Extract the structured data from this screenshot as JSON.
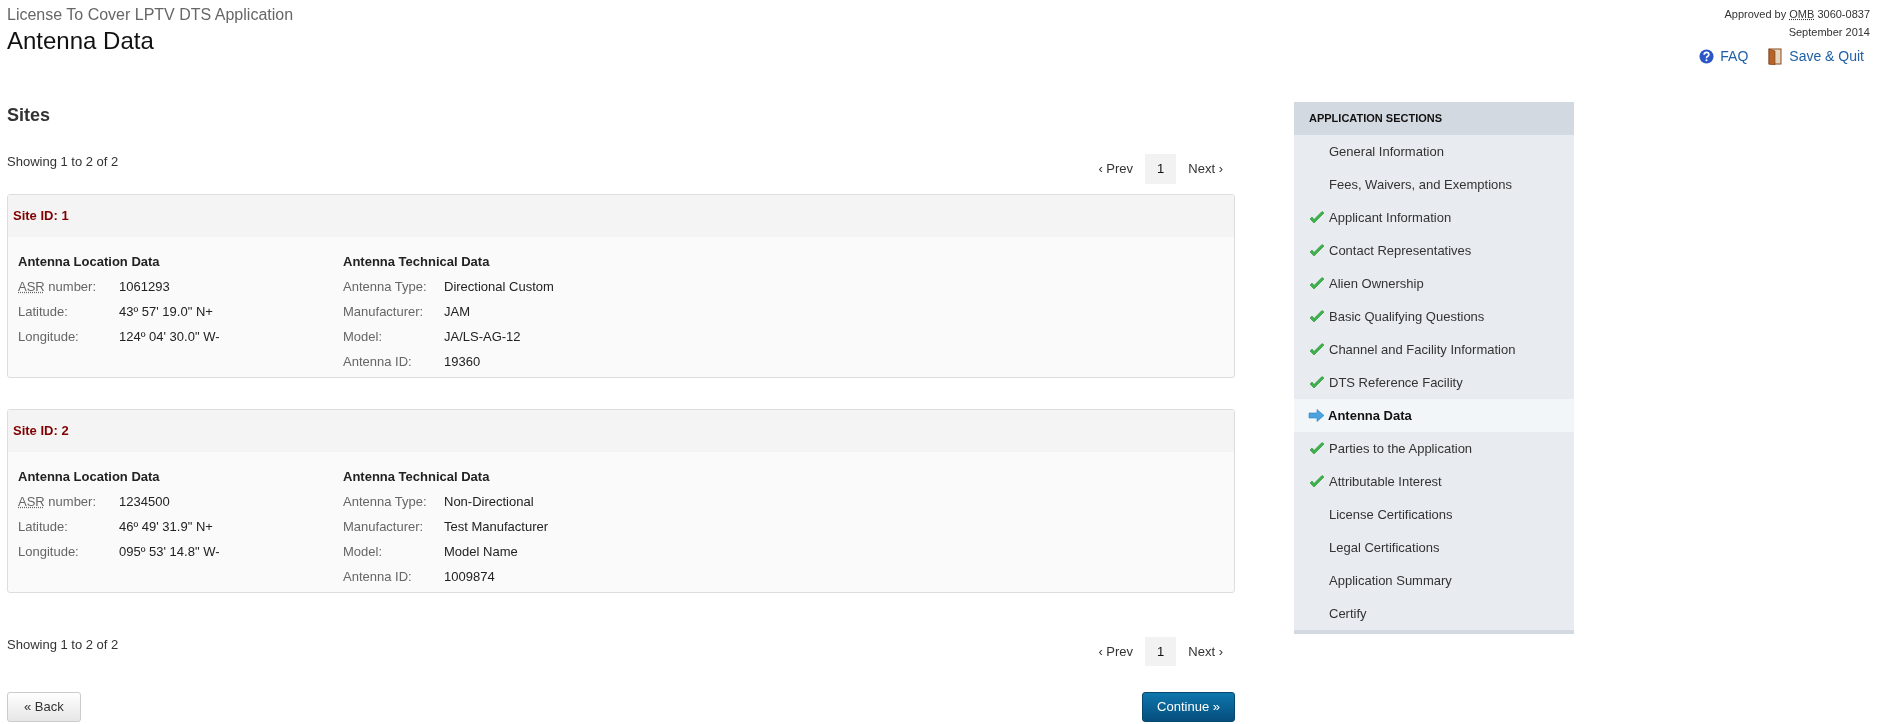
{
  "header": {
    "subtitle": "License To Cover LPTV DTS Application",
    "title": "Antenna Data",
    "approval": {
      "prefix": "Approved by",
      "abbr": "OMB",
      "suffix": "3060-0837"
    },
    "date": "September 2014",
    "links": [
      {
        "kind": "faq",
        "label": "FAQ"
      },
      {
        "kind": "quit",
        "label": "Save & Quit"
      }
    ]
  },
  "section_title": "Sites",
  "pagers": [
    {
      "summary": "Showing 1 to 2 of 2",
      "prev": "‹ Prev",
      "pages": [
        {
          "label": "1",
          "selected": true
        }
      ],
      "next": "Next ›"
    },
    {
      "summary": "Showing 1 to 2 of 2",
      "prev": "‹ Prev",
      "pages": [
        {
          "label": "1",
          "selected": true
        }
      ],
      "next": "Next ›"
    }
  ],
  "sites": [
    {
      "title": "Site ID: 1",
      "location": {
        "heading": "Antenna Location Data",
        "rows": [
          {
            "abbr": "ASR",
            "label": " number:",
            "value": "1061293"
          },
          {
            "label": "Latitude:",
            "value": "43º 57' 19.0\" N+"
          },
          {
            "label": "Longitude:",
            "value": "124º 04' 30.0\" W-"
          }
        ]
      },
      "technical": {
        "heading": "Antenna Technical Data",
        "rows": [
          {
            "label": "Antenna Type:",
            "value": "Directional Custom"
          },
          {
            "label": "Manufacturer:",
            "value": "JAM"
          },
          {
            "label": "Model:",
            "value": "JA/LS-AG-12"
          },
          {
            "label": "Antenna ID:",
            "value": "19360"
          }
        ]
      }
    },
    {
      "title": "Site ID: 2",
      "location": {
        "heading": "Antenna Location Data",
        "rows": [
          {
            "abbr": "ASR",
            "label": " number:",
            "value": "1234500"
          },
          {
            "label": "Latitude:",
            "value": "46º 49' 31.9\" N+"
          },
          {
            "label": "Longitude:",
            "value": "095º 53' 14.8\" W-"
          }
        ]
      },
      "technical": {
        "heading": "Antenna Technical Data",
        "rows": [
          {
            "label": "Antenna Type:",
            "value": "Non-Directional"
          },
          {
            "label": "Manufacturer:",
            "value": "Test Manufacturer"
          },
          {
            "label": "Model:",
            "value": "Model Name"
          },
          {
            "label": "Antenna ID:",
            "value": "1009874"
          }
        ]
      }
    }
  ],
  "buttons": {
    "back": "« Back",
    "continue": "Continue »"
  },
  "sidebar": {
    "title": "APPLICATION SECTIONS",
    "items": [
      {
        "label": "General Information",
        "checked": false,
        "selected": false
      },
      {
        "label": "Fees, Waivers, and Exemptions",
        "checked": false,
        "selected": false
      },
      {
        "label": "Applicant Information",
        "checked": true,
        "selected": false
      },
      {
        "label": "Contact Representatives",
        "checked": true,
        "selected": false
      },
      {
        "label": "Alien Ownership",
        "checked": true,
        "selected": false
      },
      {
        "label": "Basic Qualifying Questions",
        "checked": true,
        "selected": false
      },
      {
        "label": "Channel and Facility Information",
        "checked": true,
        "selected": false
      },
      {
        "label": "DTS Reference Facility",
        "checked": true,
        "selected": false
      },
      {
        "label": "Antenna Data",
        "checked": false,
        "selected": true
      },
      {
        "label": "Parties to the Application",
        "checked": true,
        "selected": false
      },
      {
        "label": "Attributable Interest",
        "checked": true,
        "selected": false
      },
      {
        "label": "License Certifications",
        "checked": false,
        "selected": false
      },
      {
        "label": "Legal Certifications",
        "checked": false,
        "selected": false
      },
      {
        "label": "Application Summary",
        "checked": false,
        "selected": false
      },
      {
        "label": "Certify",
        "checked": false,
        "selected": false
      }
    ]
  }
}
